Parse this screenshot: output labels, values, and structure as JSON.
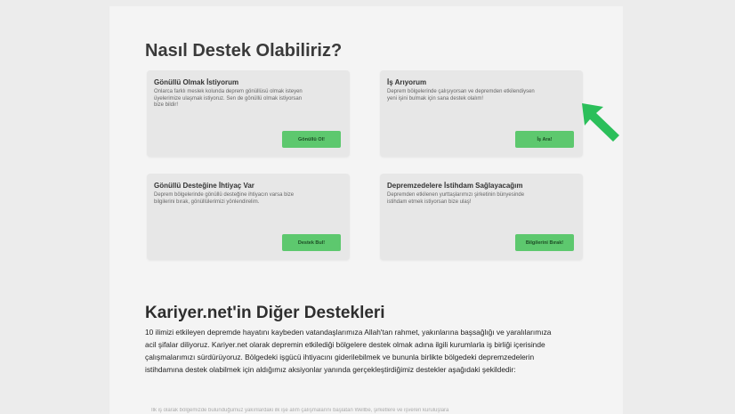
{
  "section1": {
    "title": "Nasıl Destek Olabiliriz?"
  },
  "cards": [
    {
      "title": "Gönüllü Olmak İstiyorum",
      "description": "Onlarca farklı meslek kolunda deprem gönüllüsü olmak isteyen üyelerimize ulaşmak istiyoruz. Sen de gönüllü olmak istiyorsan bize bildir!",
      "button": "Gönüllü Ol!"
    },
    {
      "title": "İş Arıyorum",
      "description": "Deprem bölgelerinde çalışıyorsan ve depremden etkilendiysen yeni işini bulmak için sana destek olalım!",
      "button": "İş Ara!"
    },
    {
      "title": "Gönüllü Desteğine İhtiyaç Var",
      "description": "Deprem bölgelerinde gönüllü desteğine ihtiyacın varsa bize bilgilerini bırak, gönüllülerimizi yönlendirelim.",
      "button": "Destek Bul!"
    },
    {
      "title": "Depremzedelere İstihdam Sağlayacağım",
      "description": "Depremden etkilenen yurttaşlarımızı şirketinin bünyesinde istihdam etmek istiyorsan bize ulaş!",
      "button": "Bilgilerini Bırak!"
    }
  ],
  "section2": {
    "title": "Kariyer.net'in Diğer Destekleri",
    "paragraph": "10 ilimizi etkileyen depremde hayatını kaybeden vatandaşlarımıza Allah'tan rahmet, yakınlarına başsağlığı ve yaralılarımıza acil şifalar diliyoruz. Kariyer.net olarak depremin etkilediği bölgelere destek olmak adına ilgili kurumlarla iş birliği içerisinde çalışmalarımızı sürdürüyoruz. Bölgedeki işgücü ihtiyacını giderilebilmek ve bununla birlikte bölgedeki depremzedelerin istihdamına destek olabilmek için aldığımız aksiyonlar yanında gerçekleştirdiğimiz destekler aşağıdaki şekildedir:",
    "faded_line": "İlk iş olarak bölgemizde bulunduğumuz yakınlardaki ilk işe alım çalışmalarını başlatan Wellbe, şirketlere ve işveren kuruluşlara"
  },
  "colors": {
    "button": "#5dc86e",
    "arrow": "#2bbf5a",
    "card": "#e7e7e7",
    "page": "#f4f4f4"
  }
}
